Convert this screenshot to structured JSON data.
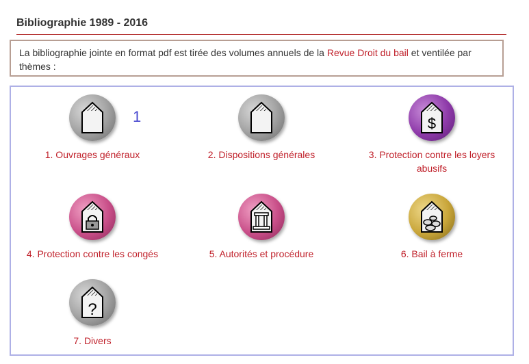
{
  "header": {
    "title": "Bibliographie 1989 - 2016"
  },
  "intro": {
    "text_before": "La bibliographie jointe en format pdf est tirée des volumes annuels de la ",
    "link": "Revue Droit du bail",
    "text_after": " et ventilée par thèmes :"
  },
  "marker": "1",
  "items": [
    {
      "label": "1. Ouvrages généraux",
      "icon": "document-icon",
      "color": "#a5a5a5"
    },
    {
      "label": "2. Dispositions générales",
      "icon": "document-icon",
      "color": "#a5a5a5"
    },
    {
      "label": "3. Protection contre les loyers abusifs",
      "icon": "dollar-tag-icon",
      "color": "#8e3aa9"
    },
    {
      "label": "4. Protection contre les congés",
      "icon": "lock-tag-icon",
      "color": "#c94f89"
    },
    {
      "label": "5. Autorités et procédure",
      "icon": "courthouse-icon",
      "color": "#c94f89"
    },
    {
      "label": "6. Bail à ferme",
      "icon": "coins-tag-icon",
      "color": "#c9a63a"
    },
    {
      "label": "7. Divers",
      "icon": "question-tag-icon",
      "color": "#a5a5a5"
    }
  ]
}
